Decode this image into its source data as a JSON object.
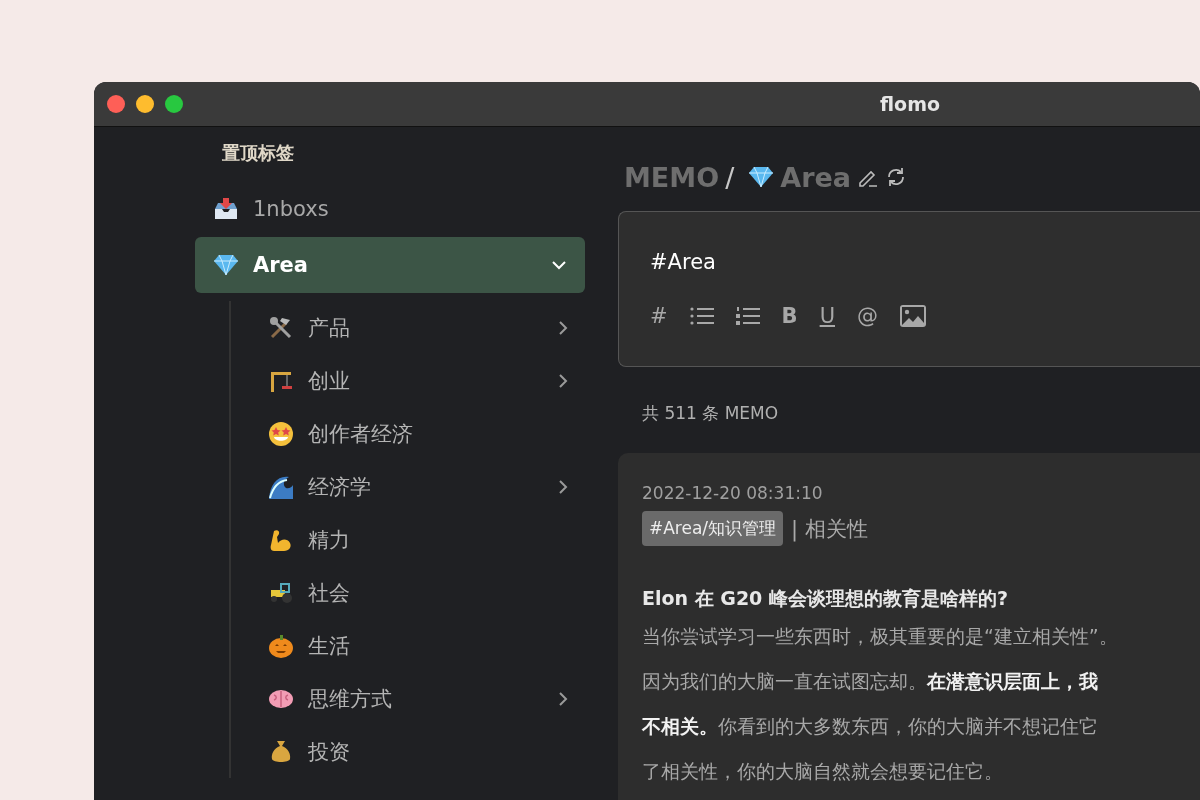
{
  "window": {
    "title": "flomo"
  },
  "sidebar": {
    "heading": "置顶标签",
    "items": [
      {
        "label": "1nboxs",
        "selected": false,
        "expandable": false
      },
      {
        "label": "Area",
        "selected": true,
        "expandable": true,
        "expanded": true,
        "children": [
          {
            "label": "产品",
            "expandable": true
          },
          {
            "label": "创业",
            "expandable": true
          },
          {
            "label": "创作者经济",
            "expandable": false
          },
          {
            "label": "经济学",
            "expandable": true
          },
          {
            "label": "精力",
            "expandable": false
          },
          {
            "label": "社会",
            "expandable": false
          },
          {
            "label": "生活",
            "expandable": false
          },
          {
            "label": "思维方式",
            "expandable": true
          },
          {
            "label": "投资",
            "expandable": false
          }
        ]
      }
    ]
  },
  "breadcrumb": {
    "root": "MEMO",
    "separator": "/",
    "current": "Area"
  },
  "editor": {
    "value": "#Area",
    "toolbar": [
      "#",
      "B",
      "U",
      "@"
    ]
  },
  "count": "共 511 条 MEMO",
  "memos": [
    {
      "time": "2022-12-20 08:31:10",
      "tag": "#Area/知识管理",
      "tag_note": "| 相关性",
      "title": "Elon 在 G20 峰会谈理想的教育是啥样的?",
      "body_lines": [
        "当你尝试学习一些东西时，极其重要的是“建立相关性”。",
        "因为我们的大脑一直在试图忘却。**在潜意识层面上，我**",
        "**不相关。**你看到的大多数东西，你的大脑并不想记住它",
        "了相关性，你的大脑自然就会想要记住它。"
      ]
    }
  ]
}
